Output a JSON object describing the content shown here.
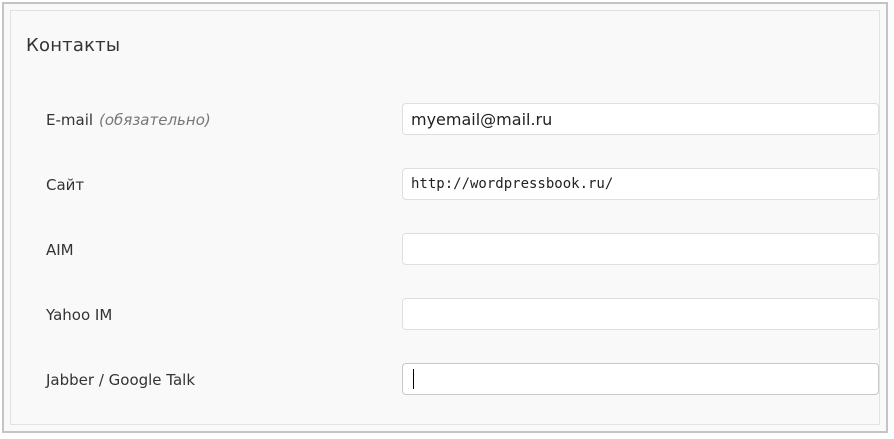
{
  "section": {
    "title": "Контакты"
  },
  "fields": [
    {
      "label": "E-mail",
      "note": "(обязательно)",
      "value": "myemail@mail.ru"
    },
    {
      "label": "Сайт",
      "value": "http://wordpressbook.ru/"
    },
    {
      "label": "AIM",
      "value": ""
    },
    {
      "label": "Yahoo IM",
      "value": ""
    },
    {
      "label": "Jabber / Google Talk",
      "value": ""
    }
  ]
}
